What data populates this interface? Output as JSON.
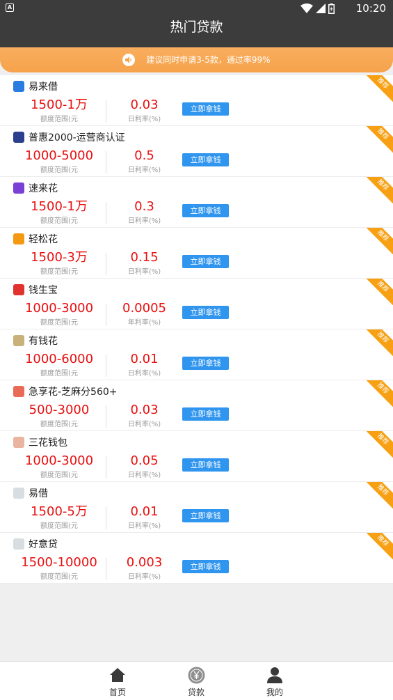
{
  "status": {
    "badge": "A",
    "time": "10:20"
  },
  "header": {
    "title": "热门贷款"
  },
  "notice": {
    "text": "建议同时申请3-5款，通过率99%"
  },
  "item_common": {
    "button_label": "立即拿钱",
    "ribbon_label": "推荐"
  },
  "items": [
    {
      "name": "易来借",
      "range": "1500-1万",
      "range_label": "额度范围(元",
      "rate": "0.03",
      "rate_label": "日利率(%)",
      "logo_color": "#2a7ce0"
    },
    {
      "name": "普惠2000-运营商认证",
      "range": "1000-5000",
      "range_label": "额度范围(元",
      "rate": "0.5",
      "rate_label": "日利率(%)",
      "logo_color": "#2b3f8f"
    },
    {
      "name": "速来花",
      "range": "1500-1万",
      "range_label": "额度范围(元",
      "rate": "0.3",
      "rate_label": "日利率(%)",
      "logo_color": "#7a3fd6"
    },
    {
      "name": "轻松花",
      "range": "1500-3万",
      "range_label": "额度范围(元",
      "rate": "0.15",
      "rate_label": "日利率(%)",
      "logo_color": "#f39a12"
    },
    {
      "name": "钱生宝",
      "range": "1000-3000",
      "range_label": "额度范围(元",
      "rate": "0.0005",
      "rate_label": "年利率(%)",
      "logo_color": "#e0322e"
    },
    {
      "name": "有钱花",
      "range": "1000-6000",
      "range_label": "额度范围(元",
      "rate": "0.01",
      "rate_label": "日利率(%)",
      "logo_color": "#c8b27a"
    },
    {
      "name": "急享花-芝麻分560+",
      "range": "500-3000",
      "range_label": "额度范围(元",
      "rate": "0.03",
      "rate_label": "日利率(%)",
      "logo_color": "#e86b57"
    },
    {
      "name": "三花钱包",
      "range": "1000-3000",
      "range_label": "额度范围(元",
      "rate": "0.05",
      "rate_label": "日利率(%)",
      "logo_color": "#e9b5a0"
    },
    {
      "name": "易借",
      "range": "1500-5万",
      "range_label": "额度范围(元",
      "rate": "0.01",
      "rate_label": "日利率(%)",
      "logo_color": "#d7dde0"
    },
    {
      "name": "好意贷",
      "range": "1500-10000",
      "range_label": "额度范围(元",
      "rate": "0.003",
      "rate_label": "日利率(%)",
      "logo_color": "#d7dde0"
    }
  ],
  "tabbar": {
    "tabs": [
      {
        "label": "首页",
        "icon": "home-icon"
      },
      {
        "label": "贷款",
        "icon": "yuan-coin-icon"
      },
      {
        "label": "我的",
        "icon": "person-icon"
      }
    ]
  }
}
